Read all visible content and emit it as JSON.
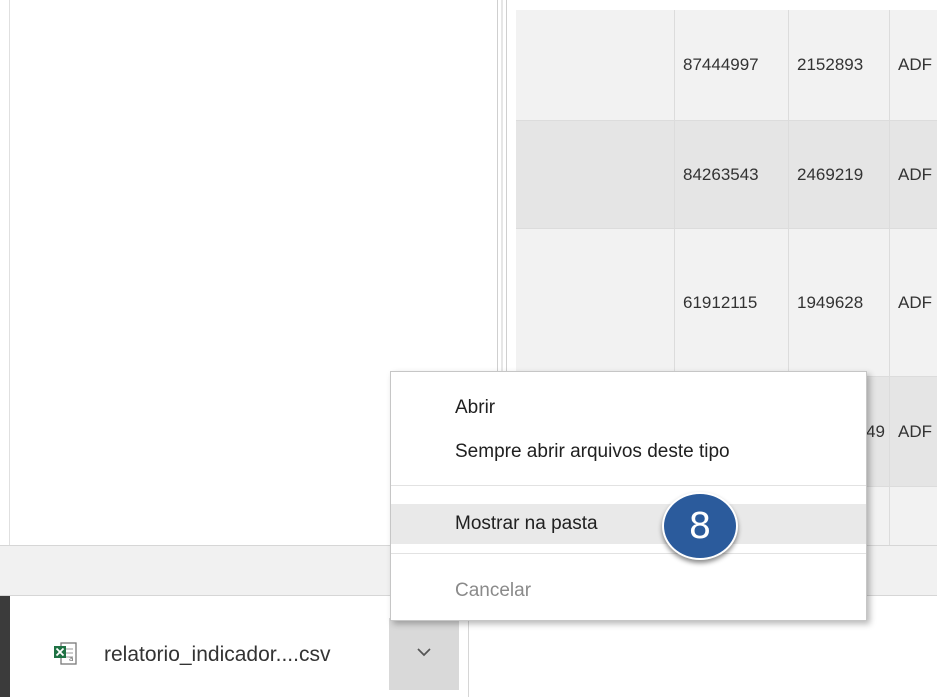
{
  "grid": {
    "rows": [
      {
        "col0": "",
        "col1": "87444997",
        "col2": "2152893",
        "col3": "ADF"
      },
      {
        "col0": "",
        "col1": "84263543",
        "col2": "2469219",
        "col3": "ADF"
      },
      {
        "col0": "",
        "col1": "61912115",
        "col2": "1949628",
        "col3": "ADF"
      },
      {
        "col0": "",
        "col1": "",
        "col2": "49",
        "col3": "ADF"
      }
    ]
  },
  "context_menu": {
    "items": [
      {
        "label": "Abrir"
      },
      {
        "label": "Sempre abrir arquivos deste tipo"
      },
      {
        "label": "Mostrar na pasta"
      },
      {
        "label": "Cancelar"
      }
    ]
  },
  "download": {
    "file_name": "relatorio_indicador....csv",
    "icon": "excel-csv-file-icon"
  },
  "step_badge": {
    "label": "8"
  },
  "colors": {
    "badge": "#2b5b9c",
    "menu_highlight": "#e9e9e9",
    "disabled_text": "#8a8a8a"
  }
}
